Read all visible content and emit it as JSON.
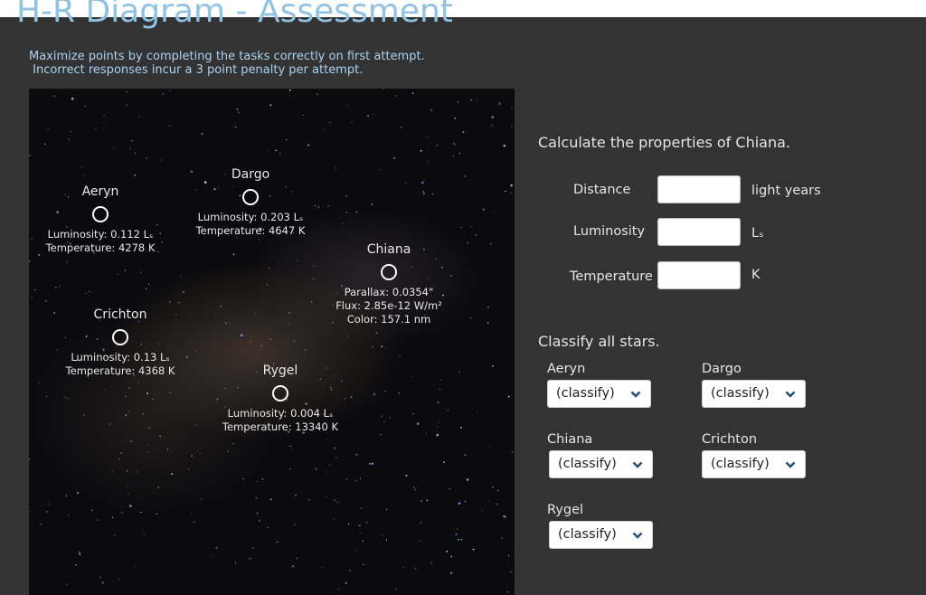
{
  "page": {
    "title": "H-R Diagram - Assessment",
    "instructions": [
      "Maximize points by completing the tasks correctly on first attempt.",
      " Incorrect responses incur a 3 point penalty per attempt."
    ]
  },
  "stars": {
    "aeryn": {
      "name": "Aeryn",
      "line1": "Luminosity:  0.112 Lₛ",
      "line2": "Temperature:  4278 K"
    },
    "dargo": {
      "name": "Dargo",
      "line1": "Luminosity:  0.203 Lₛ",
      "line2": "Temperature:  4647 K"
    },
    "chiana": {
      "name": "Chiana",
      "line1": "Parallax: 0.0354\"",
      "line2": "Flux: 2.85e-12 W/m²",
      "line3": "Color: 157.1 nm"
    },
    "crichton": {
      "name": "Crichton",
      "line1": "Luminosity:  0.13 Lₛ",
      "line2": "Temperature:  4368 K"
    },
    "rygel": {
      "name": "Rygel",
      "line1": "Luminosity:  0.004 Lₛ",
      "line2": "Temperature:  13340 K"
    }
  },
  "calculate": {
    "heading": "Calculate the properties of Chiana.",
    "fields": [
      {
        "label": "Distance",
        "value": "",
        "unit": "light years"
      },
      {
        "label": "Luminosity",
        "value": "",
        "unit": "Lₛ"
      },
      {
        "label": "Temperature",
        "value": "",
        "unit": "K"
      }
    ]
  },
  "classify": {
    "heading": "Classify all stars.",
    "items": [
      {
        "label": "Aeryn",
        "selected": "(classify)"
      },
      {
        "label": "Dargo",
        "selected": "(classify)"
      },
      {
        "label": "Chiana",
        "selected": "(classify)"
      },
      {
        "label": "Crichton",
        "selected": "(classify)"
      },
      {
        "label": "Rygel",
        "selected": "(classify)"
      }
    ]
  },
  "colors": {
    "title": "#8fc3e6",
    "instructions": "#a9d3f0",
    "background": "#333333",
    "sky": "#0b0b0d"
  }
}
